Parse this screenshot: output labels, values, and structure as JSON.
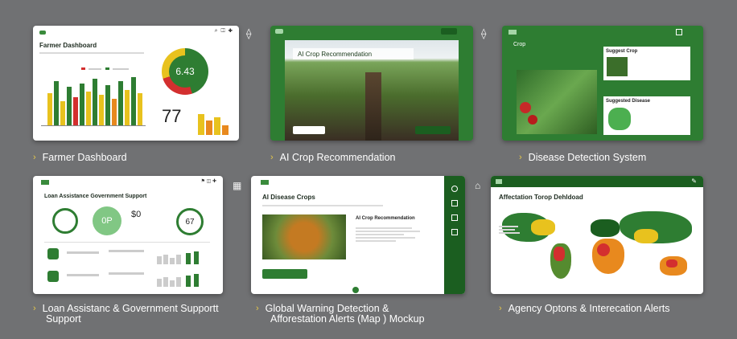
{
  "cards": {
    "farmer": {
      "title": "Farmer Dashboard",
      "gauge_value": "6.43",
      "big_number": "77",
      "caption": "Farmer Dashboard"
    },
    "crop": {
      "title": "AI Crop Recommendation",
      "caption": "AI Crop Recommendation"
    },
    "disease": {
      "title": "Crop",
      "panel1": "Suggest Crop",
      "panel2": "Suggested Disease",
      "caption": "Disease Detection System"
    },
    "loan": {
      "title": "Loan Assistance Government Support",
      "circle_value": "0P",
      "score": "$0",
      "percent": "67",
      "caption_line1": "Loan Assistanc & Government Supportt",
      "caption_line2": "Support"
    },
    "warming": {
      "title": "AI Disease Crops",
      "subtitle": "AI Crop Recommendation",
      "caption_line1": "Global Warning Detection &",
      "caption_line2": "Afforestation Alerts (Map ) Mockup"
    },
    "map": {
      "title": "Affectation Torop Dehldoad",
      "caption": "Agency Optons & Interecation Alerts"
    }
  },
  "colors": {
    "green": "#2e7d32",
    "dark_green": "#1b5e20",
    "yellow": "#e8c21e",
    "red": "#d32f2f",
    "orange": "#e8891e"
  }
}
